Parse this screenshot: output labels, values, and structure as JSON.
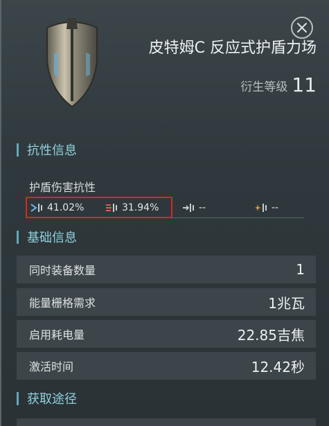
{
  "header": {
    "title": "皮特姆C 反应式护盾力场",
    "meta_label": "衍生等级",
    "meta_value": "11"
  },
  "sections": {
    "resistance": {
      "title": "抗性信息",
      "label": "护盾伤害抗性",
      "items": [
        {
          "icon": "em-damage-icon",
          "value": "41.02%",
          "color": "#6fb2e0"
        },
        {
          "icon": "thermal-damage-icon",
          "value": "31.94%",
          "color": "#e05a4c"
        },
        {
          "icon": "kinetic-damage-icon",
          "value": "--",
          "color": "#c8cdd0"
        },
        {
          "icon": "explosive-damage-icon",
          "value": "--",
          "color": "#e0a040"
        }
      ]
    },
    "basic": {
      "title": "基础信息",
      "rows": [
        {
          "label": "同时装备数量",
          "value": "1"
        },
        {
          "label": "能量栅格需求",
          "value": "1兆瓦"
        },
        {
          "label": "启用耗电量",
          "value": "22.85吉焦"
        },
        {
          "label": "激活时间",
          "value": "12.42秒"
        }
      ]
    },
    "source": {
      "title": "获取途径"
    }
  },
  "colors": {
    "accent": "#63a9b8",
    "highlight": "#e0241e"
  }
}
